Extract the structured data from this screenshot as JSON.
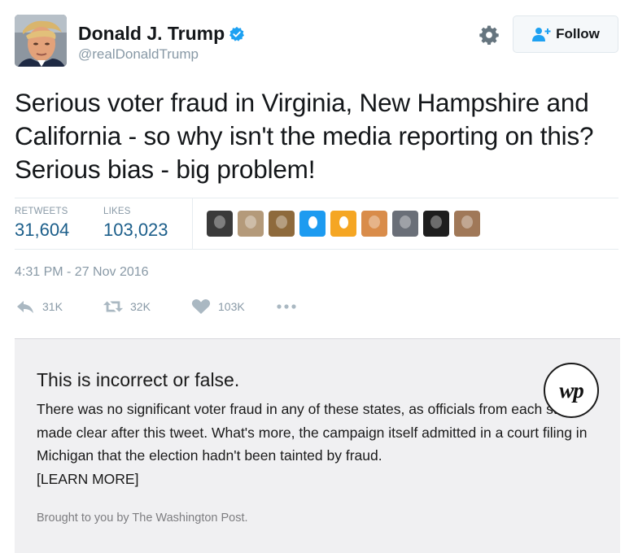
{
  "tweet": {
    "author": {
      "display_name": "Donald J. Trump",
      "handle": "@realDonaldTrump",
      "verified": true
    },
    "follow_label": "Follow",
    "text": "Serious voter fraud in Virginia, New Hampshire and California - so why isn't the media reporting on this? Serious bias - big problem!",
    "stats": {
      "retweets_label": "RETWEETS",
      "retweets": "31,604",
      "likes_label": "LIKES",
      "likes": "103,023"
    },
    "liker_avatars": [
      {
        "color": "#3a3a3a"
      },
      {
        "color": "#b49a7a"
      },
      {
        "color": "#8e6a3c"
      },
      {
        "color": "#1d9bf0",
        "egg": true
      },
      {
        "color": "#f5a623",
        "egg": true
      },
      {
        "color": "#d98c4a"
      },
      {
        "color": "#6a6f78"
      },
      {
        "color": "#1e1e1e"
      },
      {
        "color": "#a07858"
      }
    ],
    "timestamp": "4:31 PM - 27 Nov 2016",
    "actions": {
      "reply_count": "31K",
      "retweet_count": "32K",
      "like_count": "103K"
    },
    "icons": [
      "verified-badge-icon",
      "gear-icon",
      "follow-person-icon",
      "reply-icon",
      "retweet-icon",
      "heart-icon",
      "more-icon"
    ]
  },
  "fact_check": {
    "title": "This is incorrect or false.",
    "body": "There was no significant voter fraud in any of these states, as officials from each state made clear after this tweet. What's more, the campaign itself admitted in a court filing in Michigan that the election hadn't been tainted by fraud.",
    "learn_more": "[LEARN MORE]",
    "logo_text": "wp",
    "credit": "Brought to you by The Washington Post."
  },
  "colors": {
    "verified_blue": "#1da1f2",
    "stat_value": "#1b5e8a",
    "muted_text": "#8899a6",
    "fact_box_bg": "#f0f0f2"
  }
}
